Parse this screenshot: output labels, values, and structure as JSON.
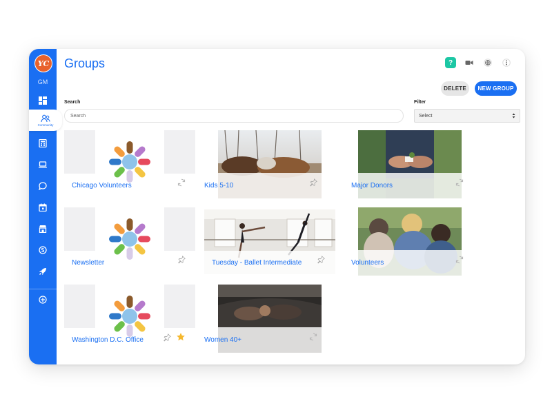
{
  "app": {
    "logo_text": "YC",
    "user_initials": "GM",
    "active_nav_label": "Community"
  },
  "page": {
    "title": "Groups"
  },
  "toolbar": {
    "delete_label": "DELETE",
    "new_group_label": "NEW GROUP",
    "help_label": "?"
  },
  "search": {
    "label": "Search",
    "placeholder": "Search"
  },
  "filter": {
    "label": "Filter",
    "selected": "Select"
  },
  "nav_icons": [
    "dashboard-icon",
    "community-icon",
    "calculator-icon",
    "laptop-icon",
    "chat-icon",
    "calendar-icon",
    "store-icon",
    "coin-icon",
    "rocket-icon",
    "add-circle-icon"
  ],
  "groups": [
    {
      "name": "Chicago Volunteers",
      "image": "hands-logo",
      "status_icon": "sync-icon"
    },
    {
      "name": "Kids 5-10",
      "image": "photo-horses",
      "status_icon": "pin-icon"
    },
    {
      "name": "Major Donors",
      "image": "photo-hands-plant",
      "status_icon": "sync-icon"
    },
    {
      "name": "Newsletter",
      "image": "hands-logo",
      "status_icon": "pin-icon"
    },
    {
      "name": "Tuesday - Ballet Intermediate",
      "image": "photo-ballet",
      "status_icon": "pin-icon"
    },
    {
      "name": "Volunteers",
      "image": "photo-kids",
      "status_icon": "sync-icon"
    },
    {
      "name": "Washington D.C. Office",
      "image": "hands-logo",
      "status_icon": "pin-icon",
      "favorite": true
    },
    {
      "name": "Women 40+",
      "image": "photo-car-women",
      "status_icon": "sync-icon"
    }
  ],
  "colors": {
    "brand": "#1a6ff2",
    "help": "#1cc7a4",
    "logo": "#e8622c",
    "star": "#f5b82e"
  }
}
